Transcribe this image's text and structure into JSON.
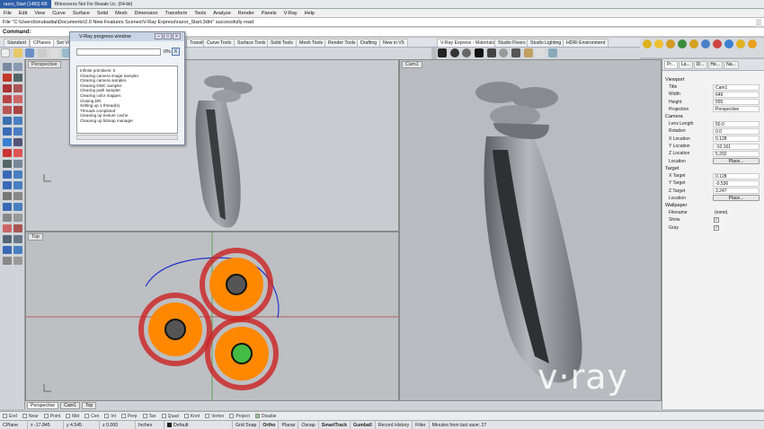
{
  "window": {
    "tabs": [
      "razor_Start (1483) KB",
      "Rhinoceros Not For Resale Lic. (64-bit)"
    ]
  },
  "menu": [
    "File",
    "Edit",
    "View",
    "Curve",
    "Surface",
    "Solid",
    "Mesh",
    "Dimension",
    "Transform",
    "Tools",
    "Analyze",
    "Render",
    "Panels",
    "V-Ray",
    "Help"
  ],
  "command": {
    "history": "File \"C:\\Users\\lonubadiai\\Documents\\2.0 New Features Scenes\\V-Ray Express\\razor_Start.3dm\" successfully read",
    "prompt": "Command:",
    "value": ""
  },
  "toolbar_tabs": {
    "left": [
      "Standard",
      "CPlanes",
      "Set View",
      "Display",
      "Select",
      "Viewport Layout",
      "Visibility",
      "Transform",
      "Curve Tools",
      "Surface Tools",
      "Solid Tools",
      "Mesh Tools",
      "Render Tools",
      "Drafting",
      "New in V5"
    ],
    "vray": [
      "V-Ray Express - Materials",
      "Studio Floors",
      "Studio Lighting",
      "HDRI Environment"
    ]
  },
  "vray_window": {
    "title": "V-Ray progress window",
    "progress_percent": 0,
    "progress_label": "0%",
    "stop_label": "X",
    "log": [
      "Infinite primitives: 0",
      "Clearing camera image sampler.",
      "Clearing camera sampler.",
      "Clearing DMC sampler.",
      "Clearing path sampler.",
      "Clearing color mapper.",
      "Closing DR.",
      "Setting up 1 thread(s)",
      "Threads completed",
      "Cleaning up texture cache",
      "Cleaning up bitmap manager"
    ]
  },
  "viewports": {
    "perspective": "Perspective",
    "top": "Top",
    "cam": "Cam1"
  },
  "viewport_tabs": [
    "Perspective",
    "Cam1",
    "Top"
  ],
  "panel": {
    "tabs": [
      "Pr...",
      "La...",
      "Di...",
      "He...",
      "Na..."
    ],
    "sections": {
      "viewport": "Viewport",
      "camera": "Camera",
      "target": "Target",
      "wallpaper": "Wallpaper"
    },
    "viewport_rows": [
      {
        "label": "Title",
        "value": "Cam1"
      },
      {
        "label": "Width",
        "value": "649"
      },
      {
        "label": "Height",
        "value": "555"
      },
      {
        "label": "Projection",
        "value": "Perspective"
      }
    ],
    "camera_rows": [
      {
        "label": "Lens Length",
        "value": "50.0"
      },
      {
        "label": "Rotation",
        "value": "0.0"
      },
      {
        "label": "X Location",
        "value": "0.128"
      },
      {
        "label": "Y Location",
        "value": "-10.161"
      },
      {
        "label": "Z Location",
        "value": "5.292"
      },
      {
        "label": "Location",
        "value": "Place..."
      }
    ],
    "target_rows": [
      {
        "label": "X Target",
        "value": "0.128"
      },
      {
        "label": "Y Target",
        "value": "-0.536"
      },
      {
        "label": "Z Target",
        "value": "3.247"
      },
      {
        "label": "Location",
        "value": "Place..."
      }
    ],
    "wallpaper_rows": [
      {
        "label": "Filename",
        "value": "(none)"
      },
      {
        "label": "Show",
        "value": "✓"
      },
      {
        "label": "Gray",
        "value": "✓"
      }
    ]
  },
  "osnaps": [
    "End",
    "Near",
    "Point",
    "Mid",
    "Cen",
    "Int",
    "Perp",
    "Tan",
    "Quad",
    "Knot",
    "Vertex",
    "Project",
    "Disable"
  ],
  "status": {
    "cplane": "CPlane",
    "x": "x -17.845",
    "y": "y 4.545",
    "z": "z 0.000",
    "units": "Inches",
    "layer": "Default",
    "grid_snap": "Grid Snap",
    "ortho": "Ortho",
    "planar": "Planar",
    "osnap": "Osnap",
    "smarttrack": "SmartTrack",
    "gumball": "Gumball",
    "record_history": "Record History",
    "filter": "Filter",
    "minutes": "Minutes from last save: 27"
  },
  "watermark": "v·ray"
}
